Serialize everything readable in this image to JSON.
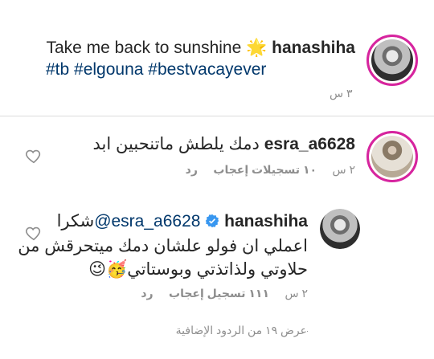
{
  "caption": {
    "text": "Take me back to sunshine",
    "emoji": "🌟",
    "username": "hanashiha",
    "hashtags": "#tb #elgouna #bestvacayever",
    "time": "٣ س"
  },
  "comments": [
    {
      "username": "esra_a6628",
      "text": "دمك يلطش ماتنحبين ابد",
      "time": "٢ س",
      "likes": "١٠ تسجيلات إعجاب",
      "reply": "رد"
    },
    {
      "username": "hanashiha",
      "mention": "@esra_a6628",
      "line1_suffix": "شكرا",
      "line2": "اعملي ان فولو علشان دمك ميتحرقش من",
      "line3": "حلاوتي ولذاتذتي وبوستاتي🥳😉",
      "time": "٢ س",
      "likes": "١١١ تسجيل إعجاب",
      "reply": "رد"
    }
  ],
  "view_more": "عرض ١٩ من الردود الإضافية",
  "colors": {
    "link": "#00376b",
    "muted": "#8e8e8e",
    "verified": "#3897f0"
  }
}
